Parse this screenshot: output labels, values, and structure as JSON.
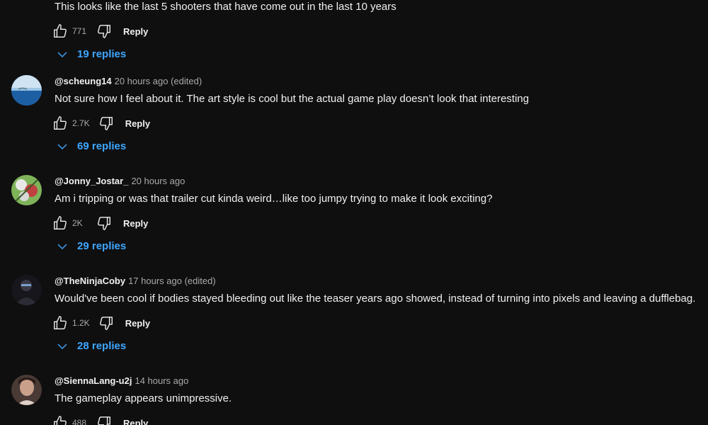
{
  "comments": [
    {
      "author": "",
      "time": "",
      "text": "This looks like the last 5 shooters that have come out in the last 10 years",
      "likes": "771",
      "reply_label": "Reply",
      "replies_label": "19 replies"
    },
    {
      "author": "@scheung14",
      "time": "20 hours ago (edited)",
      "text": "Not sure how I feel about it. The art style is cool but the actual game play doesn’t look that interesting",
      "likes": "2.7K",
      "reply_label": "Reply",
      "replies_label": "69 replies"
    },
    {
      "author": "@Jonny_Jostar_",
      "time": "20 hours ago",
      "text": "Am i tripping or was that trailer cut kinda weird…like too jumpy trying to make it look exciting?",
      "likes": "2K",
      "reply_label": "Reply",
      "replies_label": "29 replies"
    },
    {
      "author": "@TheNinjaCoby",
      "time": "17 hours ago (edited)",
      "text": "Would've been cool if bodies stayed bleeding out like the teaser years ago showed, instead of turning into pixels and leaving a dufflebag.",
      "likes": "1.2K",
      "reply_label": "Reply",
      "replies_label": "28 replies"
    },
    {
      "author": "@SiennaLang-u2j",
      "time": "14 hours ago",
      "text": "The gameplay appears unimpressive.",
      "likes": "488",
      "reply_label": "Reply",
      "replies_label": ""
    }
  ],
  "colors": {
    "background": "#0f0f0f",
    "text": "#f1f1f1",
    "secondary_text": "#aaaaaa",
    "link": "#3ea6ff"
  }
}
